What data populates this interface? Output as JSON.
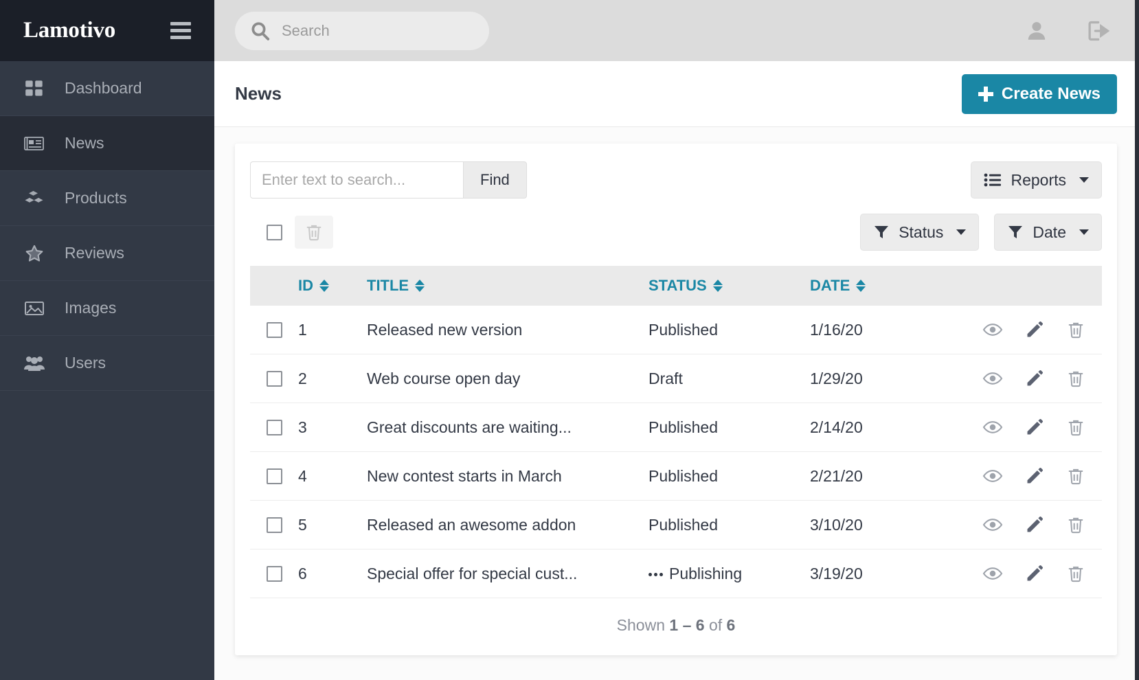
{
  "brand": {
    "name": "Lamotivo",
    "menu_icon": "hamburger-icon"
  },
  "sidebar": {
    "items": [
      {
        "label": "Dashboard",
        "icon": "grid-icon",
        "active": false
      },
      {
        "label": "News",
        "icon": "newspaper-icon",
        "active": true
      },
      {
        "label": "Products",
        "icon": "cubes-icon",
        "active": false
      },
      {
        "label": "Reviews",
        "icon": "star-icon",
        "active": false
      },
      {
        "label": "Images",
        "icon": "image-icon",
        "active": false
      },
      {
        "label": "Users",
        "icon": "users-icon",
        "active": false
      }
    ]
  },
  "topbar": {
    "search": {
      "placeholder": "Search",
      "value": "",
      "icon": "search-icon"
    },
    "icons": [
      {
        "name": "user-icon"
      },
      {
        "name": "sign-out-icon"
      }
    ]
  },
  "page": {
    "title": "News",
    "create_button": {
      "label": "Create News",
      "icon": "plus-icon",
      "color": "#1a87a5"
    }
  },
  "toolbar": {
    "search": {
      "placeholder": "Enter text to search...",
      "value": ""
    },
    "find_label": "Find",
    "reports": {
      "label": "Reports",
      "icon": "list-icon"
    }
  },
  "bulk": {
    "select_all": {
      "checked": false
    },
    "delete": {
      "icon": "trash-icon",
      "disabled": true
    },
    "filters": [
      {
        "label": "Status",
        "icon": "filter-icon"
      },
      {
        "label": "Date",
        "icon": "filter-icon"
      }
    ]
  },
  "table": {
    "columns": [
      {
        "key": "id",
        "label": "ID",
        "sortable": true
      },
      {
        "key": "title",
        "label": "TITLE",
        "sortable": true
      },
      {
        "key": "status",
        "label": "STATUS",
        "sortable": true
      },
      {
        "key": "date",
        "label": "DATE",
        "sortable": true
      }
    ],
    "rows": [
      {
        "checked": false,
        "id": "1",
        "title": "Released new version",
        "status": "Published",
        "spinner": false,
        "date": "1/16/20"
      },
      {
        "checked": false,
        "id": "2",
        "title": "Web course open day",
        "status": "Draft",
        "spinner": false,
        "date": "1/29/20"
      },
      {
        "checked": false,
        "id": "3",
        "title": "Great discounts are waiting...",
        "status": "Published",
        "spinner": false,
        "date": "2/14/20"
      },
      {
        "checked": false,
        "id": "4",
        "title": "New contest starts in March",
        "status": "Published",
        "spinner": false,
        "date": "2/21/20"
      },
      {
        "checked": false,
        "id": "5",
        "title": "Released an awesome addon",
        "status": "Published",
        "spinner": false,
        "date": "3/10/20"
      },
      {
        "checked": false,
        "id": "6",
        "title": "Special offer for special cust...",
        "status": "Publishing",
        "spinner": true,
        "date": "3/19/20"
      }
    ],
    "row_actions": [
      {
        "name": "view-icon"
      },
      {
        "name": "edit-icon"
      },
      {
        "name": "delete-icon"
      }
    ]
  },
  "footer": {
    "shown_prefix": "Shown",
    "range": "1 – 6",
    "of": "of",
    "total": "6"
  },
  "colors": {
    "accent": "#1a87a5",
    "sidebar": "#323945",
    "sidebar_dark": "#1b1f28",
    "topbar": "#dcdcdc"
  }
}
